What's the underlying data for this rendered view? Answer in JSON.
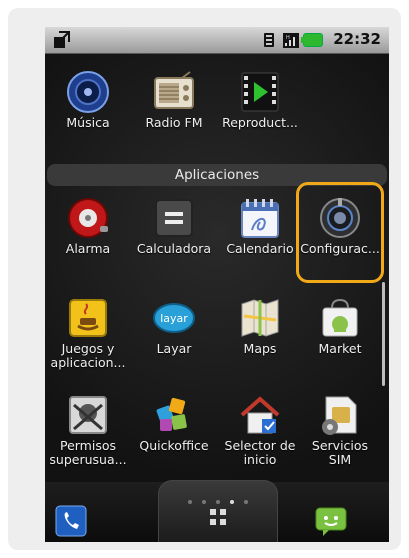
{
  "status_bar": {
    "time": "22:32"
  },
  "section": {
    "title": "Aplicaciones"
  },
  "top_row": [
    {
      "label": "Música",
      "icon": "music-speaker-icon"
    },
    {
      "label": "Radio FM",
      "icon": "radio-icon"
    },
    {
      "label": "Reproduct...",
      "icon": "video-player-icon"
    }
  ],
  "apps": [
    {
      "label": "Alarma",
      "icon": "alarm-icon"
    },
    {
      "label": "Calculadora",
      "icon": "calculator-icon"
    },
    {
      "label": "Calendario",
      "icon": "calendar-icon"
    },
    {
      "label": "Configurac...",
      "icon": "settings-icon"
    },
    {
      "label": "Juegos y\naplicacion...",
      "icon": "java-icon"
    },
    {
      "label": "Layar",
      "icon": "layar-icon"
    },
    {
      "label": "Maps",
      "icon": "maps-icon"
    },
    {
      "label": "Market",
      "icon": "market-icon"
    },
    {
      "label": "Permisos\nsuperusua...",
      "icon": "superuser-icon"
    },
    {
      "label": "Quickoffice",
      "icon": "quickoffice-icon"
    },
    {
      "label": "Selector de\ninicio",
      "icon": "home-selector-icon"
    },
    {
      "label": "Servicios\nSIM",
      "icon": "sim-services-icon"
    }
  ],
  "layar_logo_text": "layar",
  "page_dots": {
    "active_index": 3,
    "count": 5
  },
  "colors": {
    "highlight": "#f2a918"
  }
}
